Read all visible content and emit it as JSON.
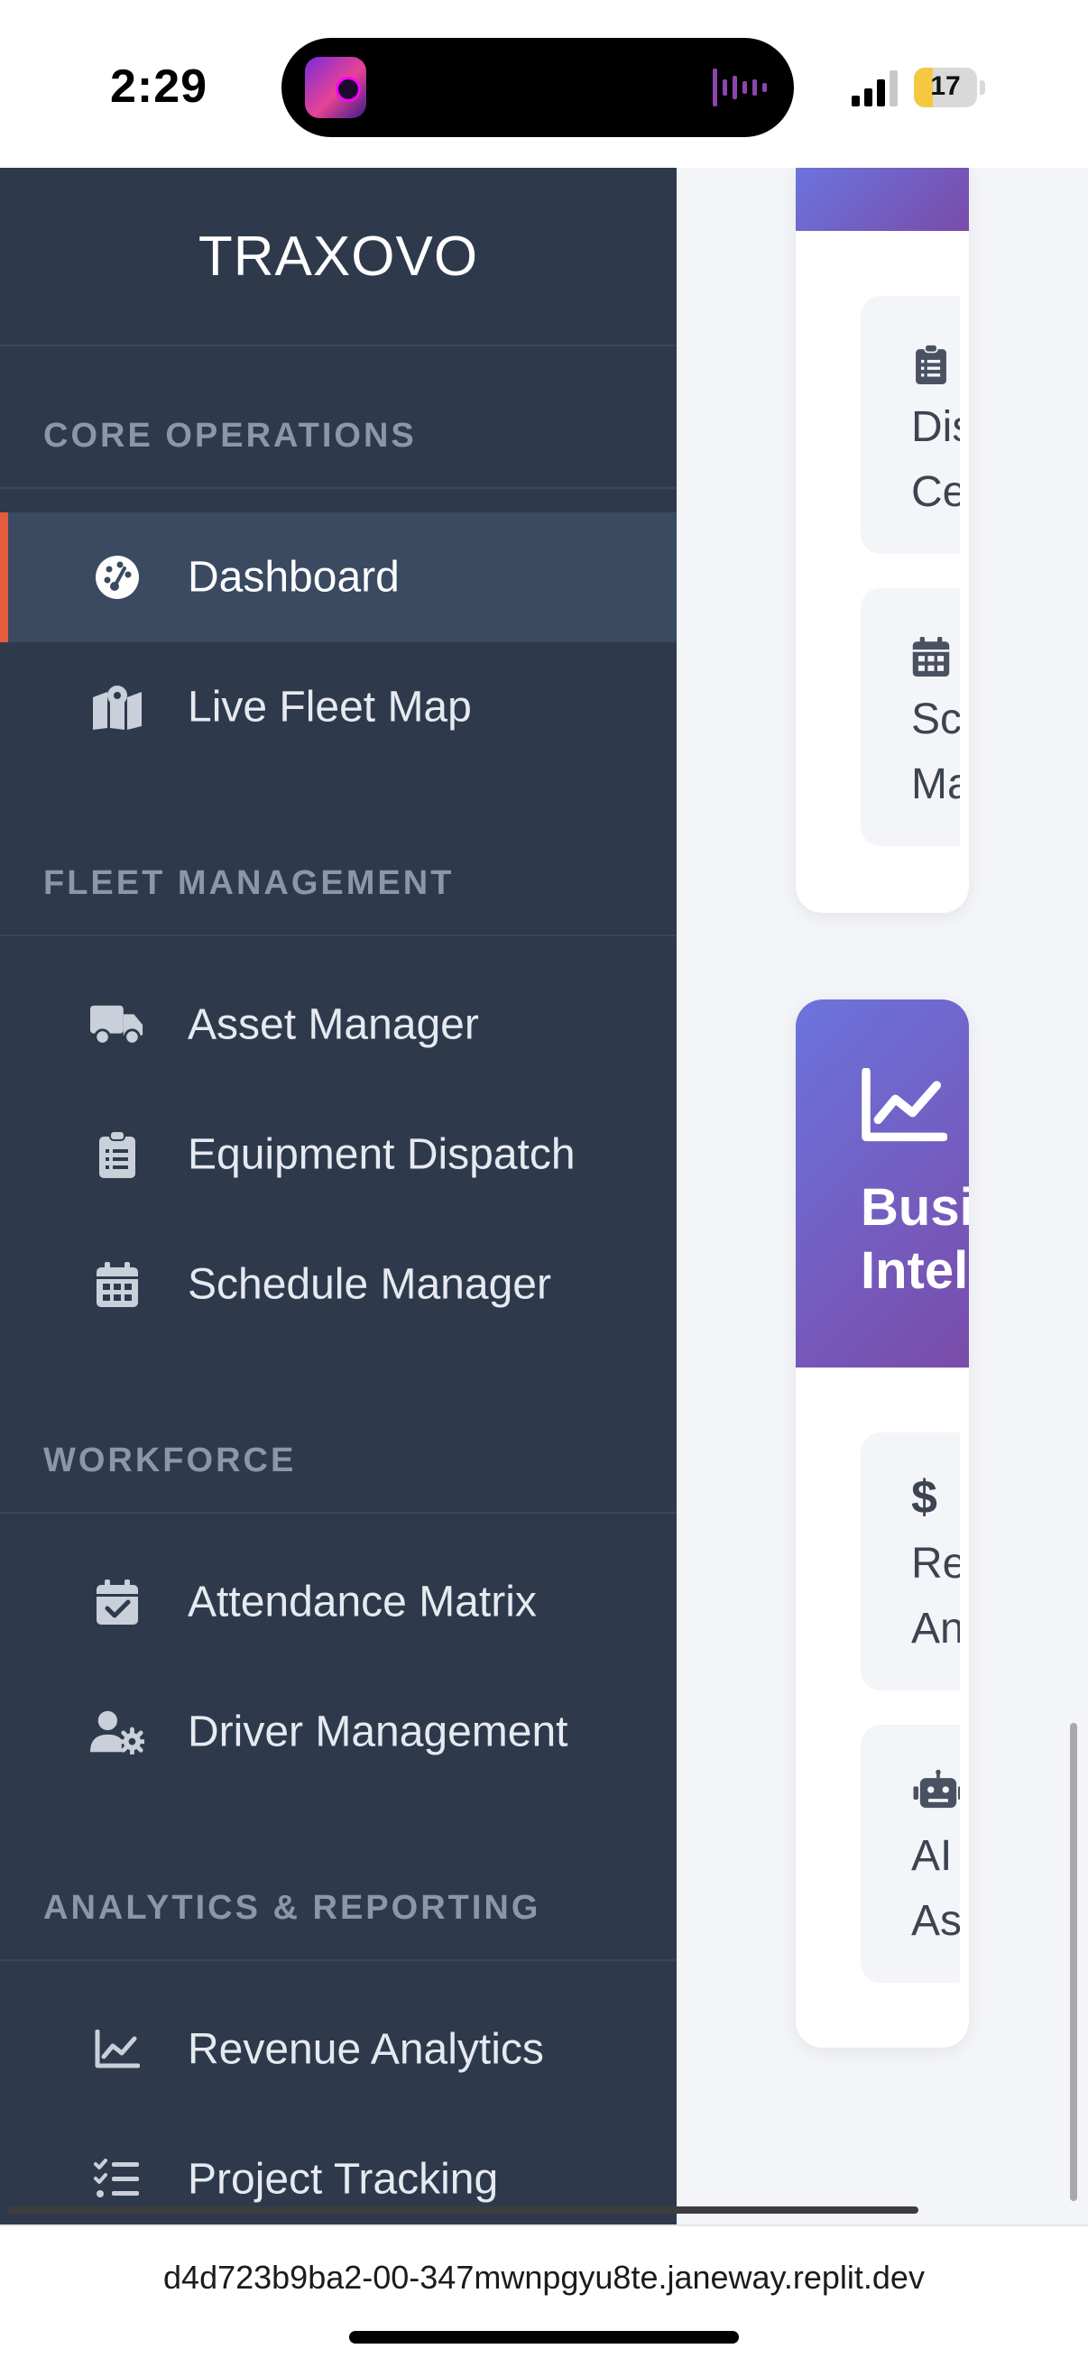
{
  "status_bar": {
    "time": "2:29",
    "battery": "17"
  },
  "sidebar": {
    "brand": "TRAXOVO",
    "sections": [
      {
        "title": "CORE OPERATIONS",
        "items": [
          {
            "label": "Dashboard",
            "icon": "dashboard-gauge-icon",
            "active": true
          },
          {
            "label": "Live Fleet Map",
            "icon": "map-icon",
            "active": false
          }
        ]
      },
      {
        "title": "FLEET MANAGEMENT",
        "items": [
          {
            "label": "Asset Manager",
            "icon": "truck-icon"
          },
          {
            "label": "Equipment Dispatch",
            "icon": "clipboard-list-icon"
          },
          {
            "label": "Schedule Manager",
            "icon": "calendar-icon"
          }
        ]
      },
      {
        "title": "WORKFORCE",
        "items": [
          {
            "label": "Attendance Matrix",
            "icon": "calendar-check-icon"
          },
          {
            "label": "Driver Management",
            "icon": "user-gear-icon"
          }
        ]
      },
      {
        "title": "ANALYTICS & REPORTING",
        "items": [
          {
            "label": "Revenue Analytics",
            "icon": "line-chart-icon"
          },
          {
            "label": "Project Tracking",
            "icon": "tasks-list-icon"
          }
        ]
      }
    ]
  },
  "main": {
    "card1": {
      "tiles": [
        {
          "line1": "Dis",
          "line2": "Ce",
          "icon": "clipboard-list-icon"
        },
        {
          "line1": "Sch",
          "line2": "Ma",
          "icon": "calendar-icon"
        }
      ]
    },
    "card2": {
      "title_line1": "Busi",
      "title_line2": "Intel",
      "icon": "line-chart-icon",
      "tiles": [
        {
          "line1": "Rev",
          "line2": "Ana",
          "icon": "dollar-icon",
          "icon_text": "$"
        },
        {
          "line1": "AI",
          "line2": "Ass",
          "icon": "robot-icon"
        }
      ]
    }
  },
  "url_bar": {
    "url": "d4d723b9ba2-00-347mwnpgyu8te.janeway.replit.dev"
  }
}
